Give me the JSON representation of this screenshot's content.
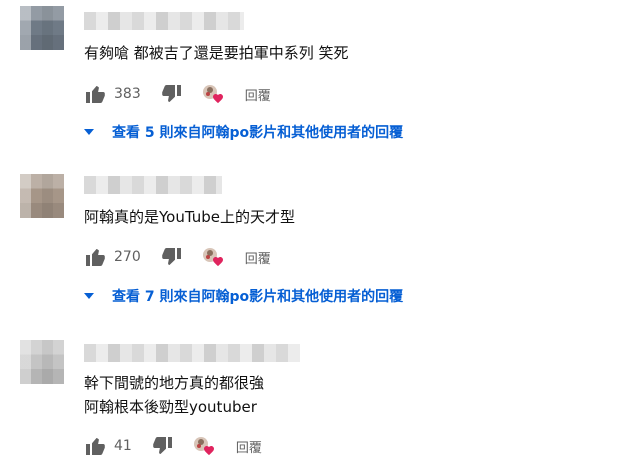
{
  "comments": [
    {
      "text_lines": [
        "有夠嗆 都被吉了還是要拍軍中系列 笑死"
      ],
      "likes": "383",
      "reply_label": "回覆",
      "view_replies": "查看 5 則來自阿翰po影片和其他使用者的回覆",
      "avatar_colors": [
        "#7d8894",
        "#5e6873"
      ]
    },
    {
      "text_lines": [
        "阿翰真的是YouTube上的天才型"
      ],
      "likes": "270",
      "reply_label": "回覆",
      "view_replies": "查看 7 則來自阿翰po影片和其他使用者的回覆",
      "avatar_colors": [
        "#b9a99b",
        "#8f8177"
      ]
    },
    {
      "text_lines": [
        "幹下間號的地方真的都很強",
        "阿翰根本後勁型youtuber"
      ],
      "likes": "41",
      "reply_label": "回覆",
      "avatar_colors": [
        "#c9c9c9",
        "#a8a8a8"
      ]
    }
  ],
  "icons": {
    "like": "thumb-up-icon",
    "dislike": "thumb-down-icon",
    "creator_heart": "creator-heart-icon",
    "expand": "caret-down-icon"
  },
  "colors": {
    "link": "#065fd4",
    "heart": "#e0245e",
    "icon": "#606060"
  }
}
